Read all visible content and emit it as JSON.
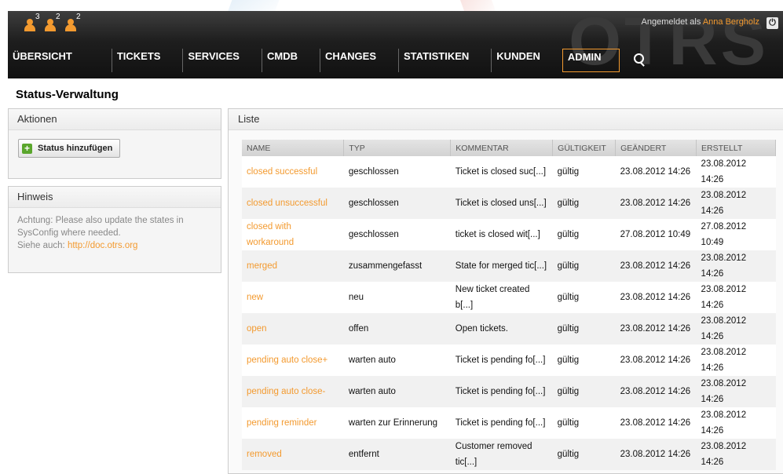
{
  "header": {
    "logo": "OTRS",
    "login_prefix": "Angemeldet als",
    "login_user": "Anna Bergholz",
    "avatars": [
      {
        "name": "online-agents",
        "count": "3"
      },
      {
        "name": "online-customers",
        "count": "2"
      },
      {
        "name": "out-of-office",
        "count": "2"
      }
    ],
    "nav": [
      "ÜBERSICHT",
      "TICKETS",
      "SERVICES",
      "CMDB",
      "CHANGES",
      "STATISTIKEN",
      "KUNDEN",
      "ADMIN"
    ],
    "active_nav": "ADMIN"
  },
  "page": {
    "title": "Status-Verwaltung"
  },
  "sidebar": {
    "actions_title": "Aktionen",
    "add_button": "Status hinzufügen",
    "hint_title": "Hinweis",
    "hint_text": "Achtung: Please also update the states in SysConfig where needed.",
    "see_also": "Siehe auch:",
    "doc_link": "http://doc.otrs.org"
  },
  "list": {
    "title": "Liste",
    "columns": [
      "NAME",
      "TYP",
      "KOMMENTAR",
      "GÜLTIGKEIT",
      "GEÄNDERT",
      "ERSTELLT"
    ],
    "rows": [
      {
        "name": "closed successful",
        "typ": "geschlossen",
        "comment": "Ticket is closed suc[...]",
        "valid": "gültig",
        "changed": "23.08.2012 14:26",
        "created": "23.08.2012 14:26"
      },
      {
        "name": "closed unsuccessful",
        "typ": "geschlossen",
        "comment": "Ticket is closed uns[...]",
        "valid": "gültig",
        "changed": "23.08.2012 14:26",
        "created": "23.08.2012 14:26"
      },
      {
        "name": "closed with workaround",
        "typ": "geschlossen",
        "comment": "ticket is closed wit[...]",
        "valid": "gültig",
        "changed": "27.08.2012 10:49",
        "created": "27.08.2012 10:49"
      },
      {
        "name": "merged",
        "typ": "zusammengefasst",
        "comment": "State for merged tic[...]",
        "valid": "gültig",
        "changed": "23.08.2012 14:26",
        "created": "23.08.2012 14:26"
      },
      {
        "name": "new",
        "typ": "neu",
        "comment": "New ticket created b[...]",
        "valid": "gültig",
        "changed": "23.08.2012 14:26",
        "created": "23.08.2012 14:26"
      },
      {
        "name": "open",
        "typ": "offen",
        "comment": "Open tickets.",
        "valid": "gültig",
        "changed": "23.08.2012 14:26",
        "created": "23.08.2012 14:26"
      },
      {
        "name": "pending auto close+",
        "typ": "warten auto",
        "comment": "Ticket is pending fo[...]",
        "valid": "gültig",
        "changed": "23.08.2012 14:26",
        "created": "23.08.2012 14:26"
      },
      {
        "name": "pending auto close-",
        "typ": "warten auto",
        "comment": "Ticket is pending fo[...]",
        "valid": "gültig",
        "changed": "23.08.2012 14:26",
        "created": "23.08.2012 14:26"
      },
      {
        "name": "pending reminder",
        "typ": "warten zur Erinnerung",
        "comment": "Ticket is pending fo[...]",
        "valid": "gültig",
        "changed": "23.08.2012 14:26",
        "created": "23.08.2012 14:26"
      },
      {
        "name": "removed",
        "typ": "entfernt",
        "comment": "Customer removed tic[...]",
        "valid": "gültig",
        "changed": "23.08.2012 14:26",
        "created": "23.08.2012 14:26"
      }
    ]
  },
  "colors": {
    "accent": "#f39a2f",
    "header_bg": "#1e1e1e",
    "add_icon": "#5aa62c"
  }
}
